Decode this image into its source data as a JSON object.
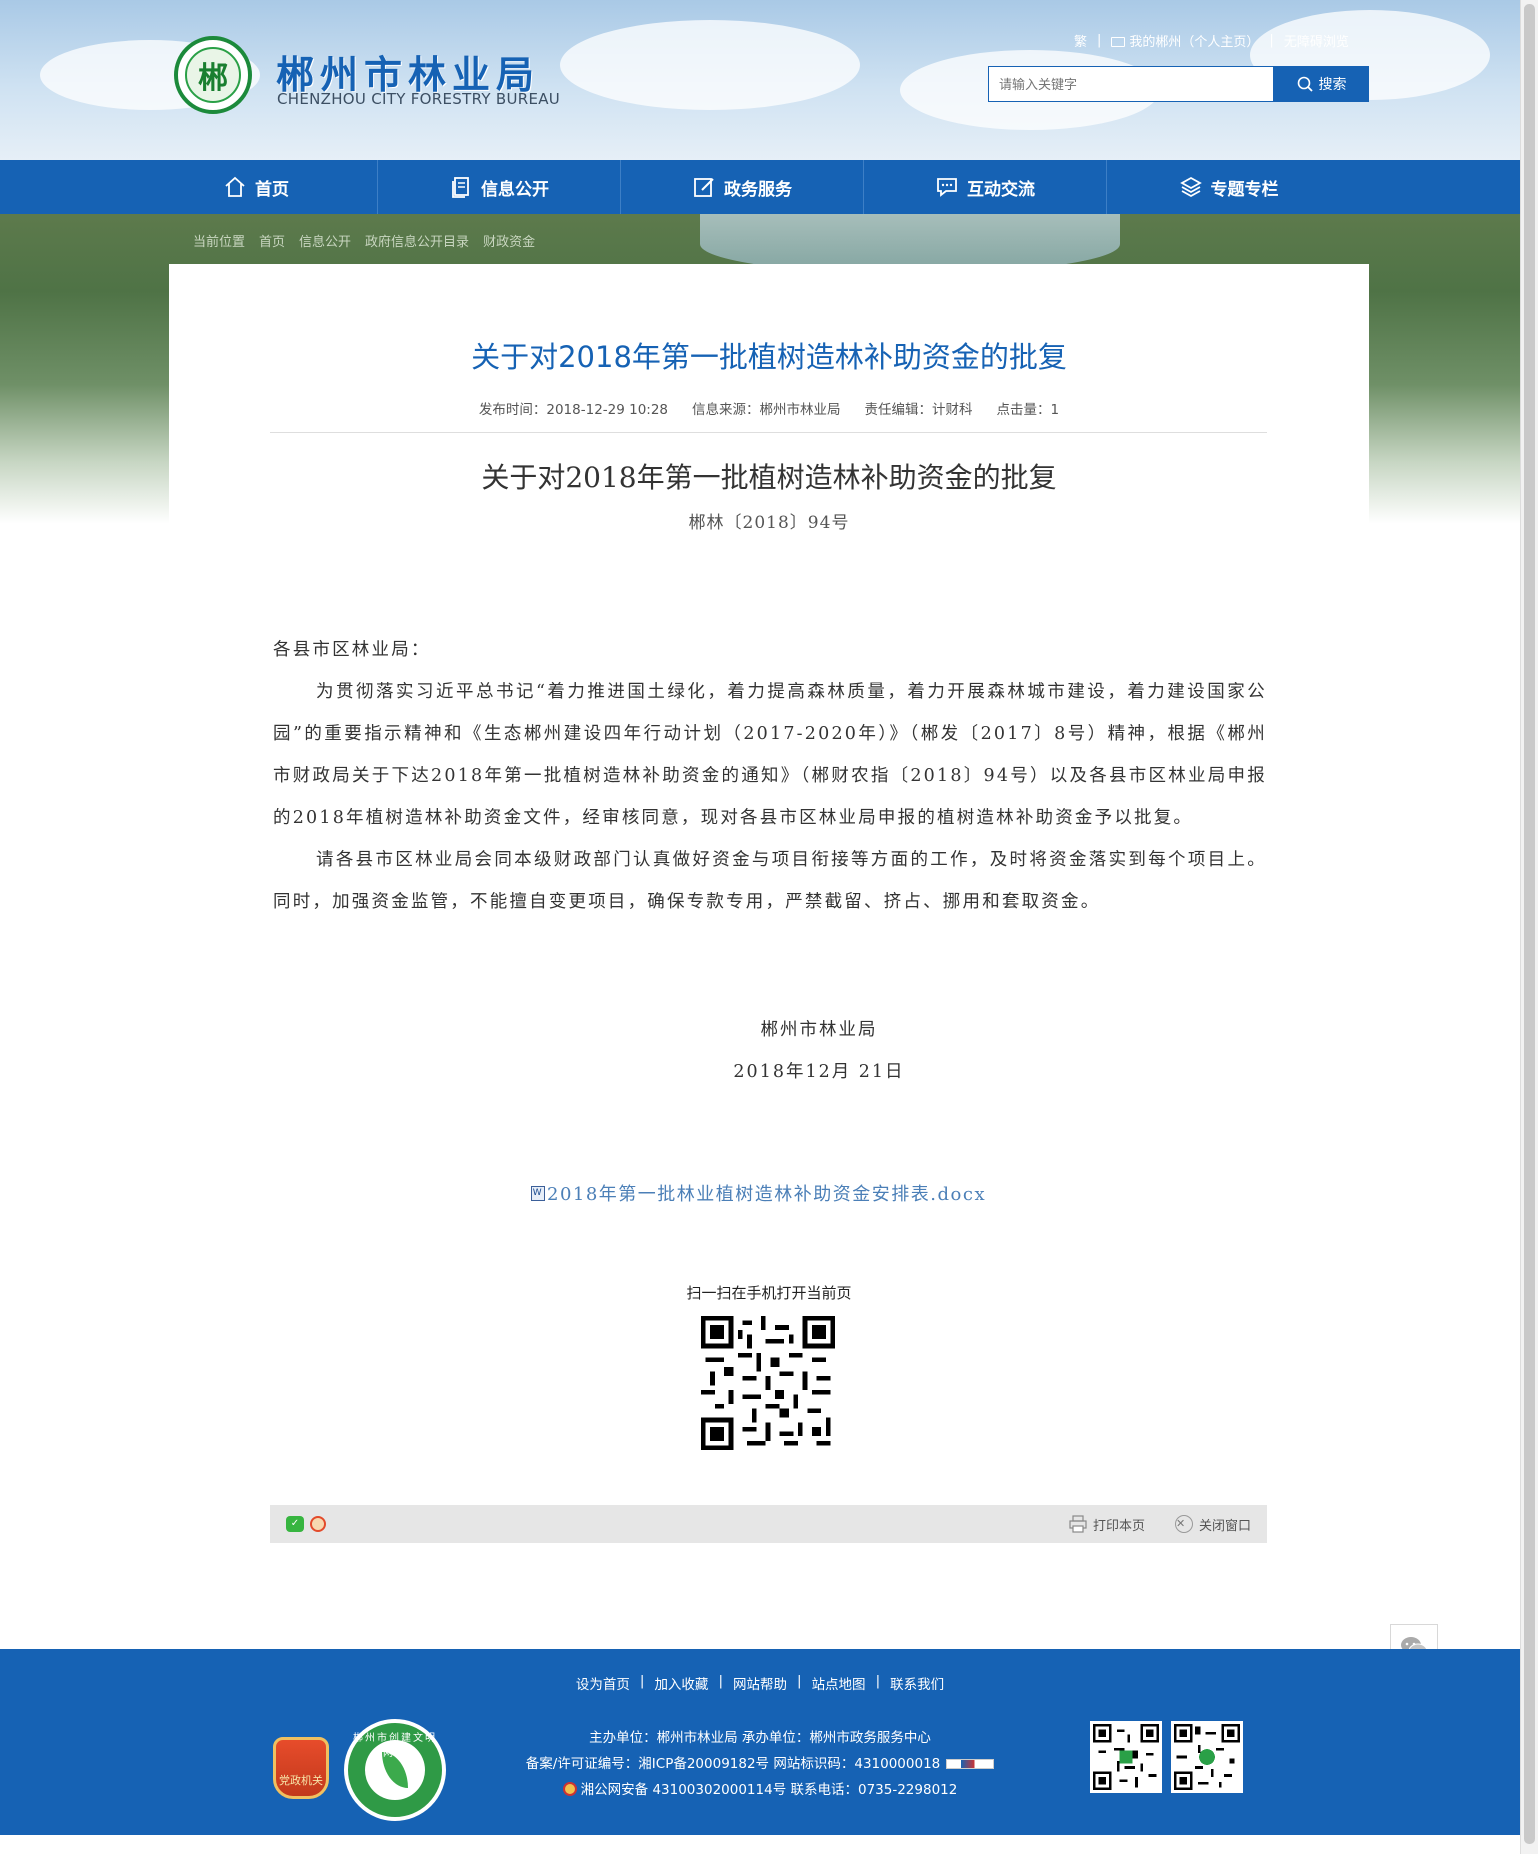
{
  "header": {
    "logo_char": "郴",
    "site_title": "郴州市林业局",
    "site_subtitle": "CHENZHOU CITY FORESTRY BUREAU",
    "top_links": [
      "繁",
      "我的郴州（个人主页）",
      "无障碍浏览"
    ],
    "search_placeholder": "请输入关键字",
    "search_button": "搜索"
  },
  "nav": [
    {
      "label": "首页",
      "icon": "home-icon"
    },
    {
      "label": "信息公开",
      "icon": "document-icon"
    },
    {
      "label": "政务服务",
      "icon": "edit-icon"
    },
    {
      "label": "互动交流",
      "icon": "chat-icon"
    },
    {
      "label": "专题专栏",
      "icon": "layers-icon"
    }
  ],
  "breadcrumb": [
    "当前位置",
    "首页",
    "信息公开",
    "政府信息公开目录",
    "财政资金"
  ],
  "article": {
    "title": "关于对2018年第一批植树造林补助资金的批复",
    "meta": {
      "publish": "发布时间：2018-12-29 10:28",
      "source": "信息来源：郴州市林业局",
      "editor": "责任编辑：计财科",
      "views": "点击量：1"
    },
    "doc_title": "关于对2018年第一批植树造林补助资金的批复",
    "doc_number": "郴林〔2018〕94号",
    "salutation": "各县市区林业局：",
    "paragraphs": [
      "为贯彻落实习近平总书记“着力推进国土绿化，着力提高森林质量，着力开展森林城市建设，着力建设国家公园”的重要指示精神和《生态郴州建设四年行动计划（2017-2020年）》（郴发〔2017〕8号）精神，根据《郴州市财政局关于下达2018年第一批植树造林补助资金的通知》（郴财农指〔2018〕94号）以及各县市区林业局申报的2018年植树造林补助资金文件，经审核同意，现对各县市区林业局申报的植树造林补助资金予以批复。",
      "请各县市区林业局会同本级财政部门认真做好资金与项目衔接等方面的工作，及时将资金落实到每个项目上。同时，加强资金监管，不能擅自变更项目，确保专款专用，严禁截留、挤占、挪用和套取资金。"
    ],
    "signature_org": "郴州市林业局",
    "signature_date": "2018年12月 21日",
    "attachment": "2018年第一批林业植树造林补助资金安排表.docx",
    "qr_label": "扫一扫在手机打开当前页"
  },
  "tools": {
    "print": "打印本页",
    "close": "关闭窗口"
  },
  "footer": {
    "links": [
      "设为首页",
      "加入收藏",
      "网站帮助",
      "站点地图",
      "联系我们"
    ],
    "line1": "主办单位：郴州市林业局   承办单位：郴州市政务服务中心",
    "line2": "备案/许可证编号：湘ICP备20009182号   网站标识码：4310000018",
    "line3": "湘公网安备 43100302000114号   联系电话：0735-2298012",
    "badge1_text": "党政机关",
    "badge2_text": "郴州市创建文明网站"
  },
  "colors": {
    "brand": "#1662b4",
    "title_blue": "#1662b4",
    "link_blue": "#4b7fb7"
  }
}
